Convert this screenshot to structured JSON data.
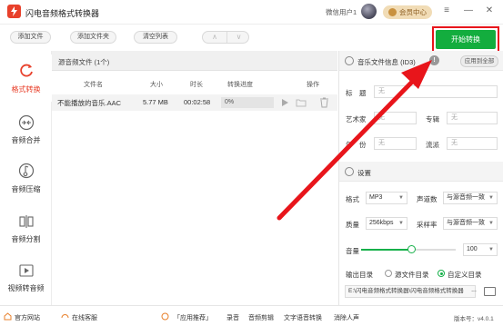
{
  "app": {
    "title": "闪电音频格式转换器"
  },
  "account": {
    "username": "微信用户1",
    "vip_label": "会员中心"
  },
  "window": {
    "menu": "≡",
    "minimize": "—",
    "close": "✕"
  },
  "toolbar": {
    "add_file": "添加文件",
    "add_folder": "添加文件夹",
    "clear_list": "清空列表",
    "move_up": "∧",
    "move_down": "∨",
    "start": "开始转换"
  },
  "sidebar": {
    "items": [
      {
        "label": "格式转换",
        "icon": "refresh-icon",
        "active": true
      },
      {
        "label": "音频合并",
        "icon": "merge-icon",
        "active": false
      },
      {
        "label": "音频压缩",
        "icon": "compress-icon",
        "active": false
      },
      {
        "label": "音频分割",
        "icon": "split-icon",
        "active": false
      },
      {
        "label": "视频转音频",
        "icon": "video-icon",
        "active": false
      }
    ]
  },
  "filelist": {
    "title": "源音频文件 (1个)",
    "columns": [
      "文件名",
      "大小",
      "时长",
      "转换进度",
      "操作"
    ],
    "rows": [
      {
        "name": "不能播放的音乐.AAC",
        "size": "5.77 MB",
        "duration": "00:02:58",
        "progress": "0%"
      }
    ]
  },
  "info": {
    "title": "音乐文件信息 (ID3)",
    "info_icon": "!",
    "apply_all": "应用到全部",
    "fields": {
      "title_label": "标　题",
      "artist_label": "艺术家",
      "album_label": "专辑",
      "year_label": "年　份",
      "genre_label": "流派",
      "empty": "无"
    }
  },
  "settings": {
    "title": "设置",
    "format_label": "格式",
    "format_value": "MP3",
    "channels_label": "声道数",
    "channels_value": "与源音频一致",
    "quality_label": "质量",
    "quality_value": "256kbps",
    "samplerate_label": "采样率",
    "samplerate_value": "与源音频一致",
    "volume_label": "音量",
    "volume_value": "100",
    "volume_level": 0.53,
    "output_label": "输出目录",
    "source_dir": "源文件目录",
    "custom_dir": "自定义目录",
    "output_path": "E:\\闪电音频格式转换器\\闪电音频格式转换器",
    "more": "..."
  },
  "footer": {
    "website": "官方网站",
    "support": "在线客服",
    "recommend": "「应用推荐」",
    "links": [
      "录音",
      "音频剪辑",
      "文字语音转换",
      "消除人声"
    ],
    "version": "版本号：v4.0.1"
  },
  "colors": {
    "accent_red": "#e8402b",
    "start_green": "#13ad3e",
    "highlight_red": "#e8151b"
  }
}
